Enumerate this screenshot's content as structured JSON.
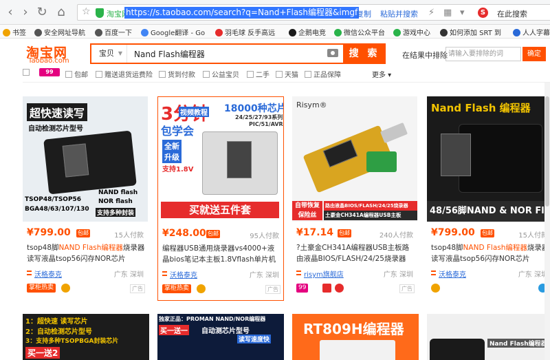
{
  "browser": {
    "site_name": "淘宝网",
    "url": "https://s.taobao.com/search?q=Nand+Flash编程器&imgf",
    "copy_label": "复制",
    "paste_search_label": "粘贴并搜索",
    "search_label": "在此搜索"
  },
  "bookmarks": [
    {
      "label": "书签",
      "color": "#f0a300"
    },
    {
      "label": "安全网址导航",
      "color": "#555555"
    },
    {
      "label": "百度一下",
      "color": "#555555"
    },
    {
      "label": "Google翻译 - Go",
      "color": "#4285f4"
    },
    {
      "label": "羽毛球 反手高远",
      "color": "#e62c2c"
    },
    {
      "label": "企鹅电竞",
      "color": "#1a1a1a"
    },
    {
      "label": "微信公众平台",
      "color": "#2ab34a"
    },
    {
      "label": "游戏中心",
      "color": "#2ab34a"
    },
    {
      "label": "如何添加 SRT 到",
      "color": "#333333"
    },
    {
      "label": "人人字幕",
      "color": "#2a6ad8"
    }
  ],
  "header": {
    "logo_text": "淘宝网",
    "logo_sub": "Taobao.com",
    "search_category": "宝贝",
    "search_query": "Nand Flash编程器",
    "search_button": "搜 索",
    "exclude_label": "在结果中排除",
    "exclude_placeholder": "请输入要排除的词",
    "exclude_button": "确定"
  },
  "filters": {
    "tag_99": "99",
    "items": [
      "包邮",
      "赠送退货运费险",
      "货到付款",
      "公益宝贝",
      "二手",
      "天猫",
      "正品保障"
    ],
    "more": "更多"
  },
  "products": [
    {
      "price": "¥799.00",
      "shipping": "包邮",
      "sales": "15人付款",
      "title_parts": [
        "tsop48脚",
        "NAND Flash编程器",
        "烧录器读写液晶tsop56闪存NOR芯片"
      ],
      "shop": "沃格泰克",
      "location": "广东 深圳",
      "badge": "掌柜热卖",
      "ad": "广告",
      "img_texts": [
        "超快速读写",
        "自动检测芯片型号",
        "NAND flash",
        "NOR flash",
        "TSOP48/TSOP56",
        "BGA48/63/107/130",
        "支持多种封装"
      ]
    },
    {
      "price": "¥248.00",
      "shipping": "包邮",
      "sales": "95人付款",
      "title_parts": [
        "",
        "编程器USB通用烧录器vs4000+液晶bios笔记本主板1.8Vflash单片机",
        ""
      ],
      "shop": "沃格泰克",
      "location": "广东 深圳",
      "badge": "掌柜热卖",
      "ad": "广告",
      "img_texts": [
        "3分钟",
        "视频教程",
        "包学会",
        "18000种芯片",
        "24/25/27/93系列",
        "PIC/51/AVR",
        "全新",
        "升级",
        "支持1.8V",
        "买就送五件套"
      ]
    },
    {
      "price": "¥17.14",
      "shipping": "包邮",
      "sales": "240人付款",
      "title_parts": [
        "",
        "?土豪金CH341A编程器USB主板路由液晶BIOS/FLASH/24/25烧录器",
        ""
      ],
      "shop": "risym旗舰店",
      "location": "广东 深圳",
      "badge": "99",
      "ad": "广告",
      "img_texts": [
        "Risym®",
        "自带恢复",
        "保险丝",
        "路由液晶BIOS/FLASH/24/25烧录器",
        "土豪金CH341A编程器USB主板"
      ]
    },
    {
      "price": "¥799.00",
      "shipping": "包邮",
      "sales": "15人付款",
      "title_parts": [
        "tsop48脚",
        "NAND Flash编程器",
        "烧录器读写液晶tsop56闪存NOR芯片"
      ],
      "shop": "沃格泰克",
      "location": "广东 深圳",
      "badge": "",
      "ad": "",
      "img_texts": [
        "Nand Flash 编程器",
        "48/56脚NAND & NOR Flash"
      ]
    }
  ],
  "row2": [
    {
      "img_texts": [
        "1：超快速 读写芯片",
        "2：自动检测芯片型号",
        "3：支持多种TSOPBGA封装芯片",
        "买一送",
        "2"
      ]
    },
    {
      "img_texts": [
        "独家正品：PROMAN NAND/NOR编程器",
        "买一送一",
        "自动测芯片型号",
        "读写速度快"
      ]
    },
    {
      "img_texts": [
        "RT809H编程器"
      ]
    },
    {
      "img_texts": [
        "Nand Flash编程器"
      ]
    }
  ]
}
